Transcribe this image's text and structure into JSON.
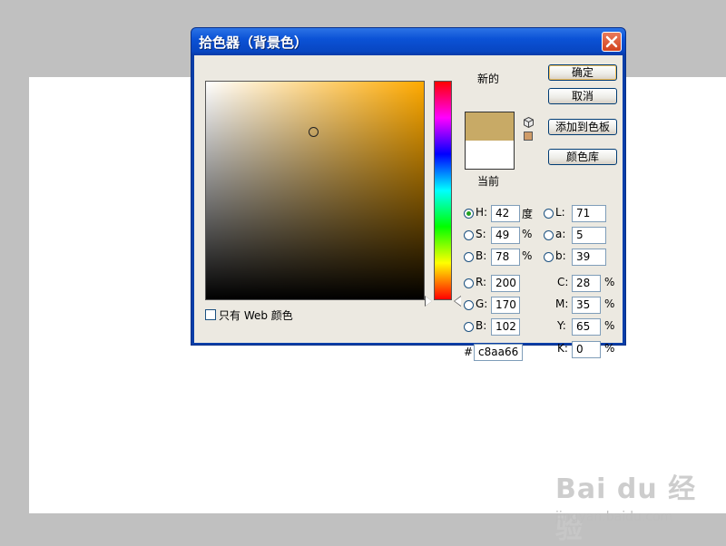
{
  "dialog": {
    "title": "拾色器（背景色）",
    "hue_color": "#ffaa00",
    "buttons": {
      "ok": "确定",
      "cancel": "取消",
      "add_to_swatches": "添加到色板",
      "color_libraries": "颜色库"
    },
    "swatch": {
      "new_label": "新的",
      "current_label": "当前",
      "new_color": "#c8aa66",
      "current_color": "#ffffff",
      "gamut_color": "#d09c68"
    },
    "hsb": [
      {
        "label": "H:",
        "value": "42",
        "unit": "度",
        "checked": true
      },
      {
        "label": "S:",
        "value": "49",
        "unit": "%",
        "checked": false
      },
      {
        "label": "B:",
        "value": "78",
        "unit": "%",
        "checked": false
      }
    ],
    "rgb": [
      {
        "label": "R:",
        "value": "200"
      },
      {
        "label": "G:",
        "value": "170"
      },
      {
        "label": "B:",
        "value": "102"
      }
    ],
    "lab": [
      {
        "label": "L:",
        "value": "71"
      },
      {
        "label": "a:",
        "value": "5"
      },
      {
        "label": "b:",
        "value": "39"
      }
    ],
    "cmyk": [
      {
        "label": "C:",
        "value": "28",
        "unit": "%"
      },
      {
        "label": "M:",
        "value": "35",
        "unit": "%"
      },
      {
        "label": "Y:",
        "value": "65",
        "unit": "%"
      },
      {
        "label": "K:",
        "value": "0",
        "unit": "%"
      }
    ],
    "hex": {
      "label": "#",
      "value": "c8aa66"
    },
    "web_only_label": "只有 Web 颜色",
    "web_only_checked": false
  },
  "watermark": {
    "brand": "Bai du 经验",
    "url": "jingyan.baidu.com"
  }
}
